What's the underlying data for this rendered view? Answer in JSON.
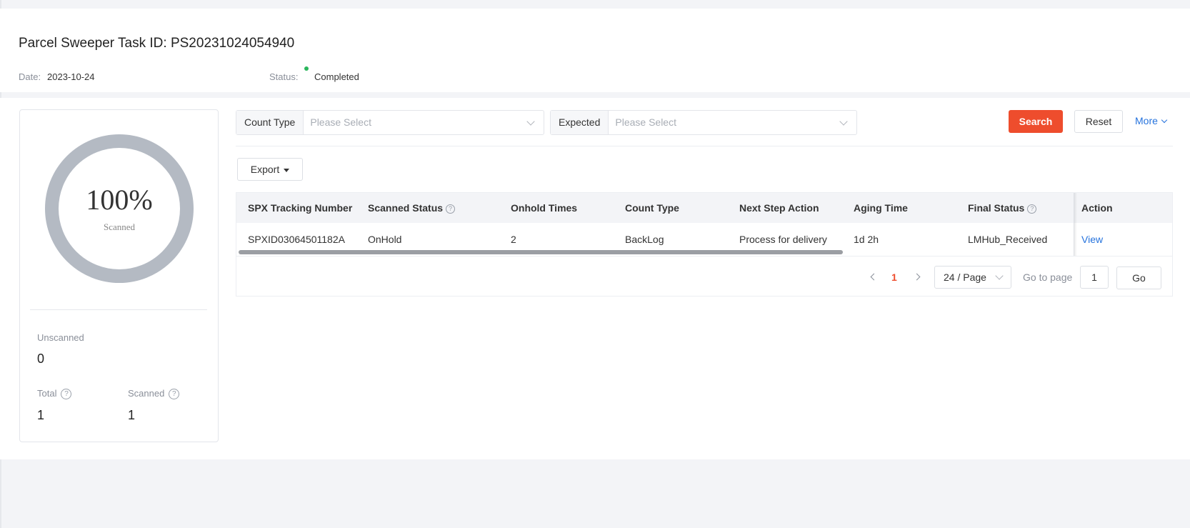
{
  "header": {
    "title": "Parcel Sweeper Task ID: PS20231024054940",
    "date_label": "Date:",
    "date_value": "2023-10-24",
    "status_label": "Status:",
    "status_value": "Completed",
    "status_color": "#2bb65c"
  },
  "summary": {
    "percent": "100%",
    "percent_caption": "Scanned",
    "unscanned_label": "Unscanned",
    "unscanned_value": "0",
    "total_label": "Total",
    "total_value": "1",
    "scanned_label": "Scanned",
    "scanned_value": "1",
    "help_icon": "question-circle-icon"
  },
  "filters": {
    "count_type_label": "Count Type",
    "count_type_placeholder": "Please Select",
    "expected_label": "Expected",
    "expected_placeholder": "Please Select",
    "search_label": "Search",
    "reset_label": "Reset",
    "more_label": "More",
    "accent_color": "#ee4d2d",
    "link_color": "#2673dd"
  },
  "toolbar": {
    "export_label": "Export"
  },
  "table": {
    "columns": [
      "SPX Tracking Number",
      "Scanned Status",
      "Onhold Times",
      "Count Type",
      "Next Step Action",
      "Aging Time",
      "Final Status",
      "Action"
    ],
    "rows": [
      [
        "SPXID03064501182A",
        "OnHold",
        "2",
        "BackLog",
        "Process for delivery",
        "1d 2h",
        "LMHub_Received",
        "View"
      ]
    ]
  },
  "pagination": {
    "current_page": "1",
    "page_size": "24 / Page",
    "goto_label": "Go to page",
    "goto_value": "1",
    "go_label": "Go"
  }
}
